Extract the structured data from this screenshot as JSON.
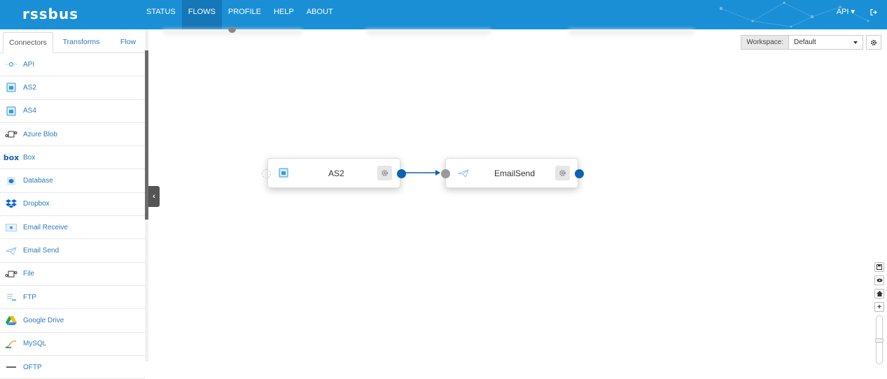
{
  "app": {
    "logo": "rssbus"
  },
  "nav": {
    "items": [
      {
        "label": "STATUS",
        "active": false
      },
      {
        "label": "FLOWS",
        "active": true
      },
      {
        "label": "PROFILE",
        "active": false
      },
      {
        "label": "HELP",
        "active": false
      },
      {
        "label": "ABOUT",
        "active": false
      }
    ],
    "user_menu": "API ▾"
  },
  "sidebar": {
    "tabs": [
      "Connectors",
      "Transforms",
      "Flow"
    ],
    "connectors": [
      {
        "label": "API",
        "icon": "api-icon"
      },
      {
        "label": "AS2",
        "icon": "as2-icon"
      },
      {
        "label": "AS4",
        "icon": "as4-icon"
      },
      {
        "label": "Azure Blob",
        "icon": "azure-blob-icon"
      },
      {
        "label": "Box",
        "icon": "box-logo-icon"
      },
      {
        "label": "Database",
        "icon": "database-icon"
      },
      {
        "label": "Dropbox",
        "icon": "dropbox-icon"
      },
      {
        "label": "Email Receive",
        "icon": "email-receive-icon"
      },
      {
        "label": "Email Send",
        "icon": "email-send-icon"
      },
      {
        "label": "File",
        "icon": "file-icon"
      },
      {
        "label": "FTP",
        "icon": "ftp-icon"
      },
      {
        "label": "Google Drive",
        "icon": "google-drive-icon"
      },
      {
        "label": "MySQL",
        "icon": "mysql-icon"
      },
      {
        "label": "OFTP",
        "icon": "oftp-icon"
      }
    ]
  },
  "workspace": {
    "label": "Workspace:",
    "value": "Default"
  },
  "flow": {
    "nodes": [
      {
        "title": "AS2",
        "icon": "as2-icon"
      },
      {
        "title": "EmailSend",
        "icon": "email-send-icon"
      }
    ]
  },
  "colors": {
    "navbar": "#1a8fd6",
    "active_nav": "#1576b8",
    "link": "#2a7bbf",
    "port_out": "#0d63b3",
    "port_in": "#999999"
  }
}
